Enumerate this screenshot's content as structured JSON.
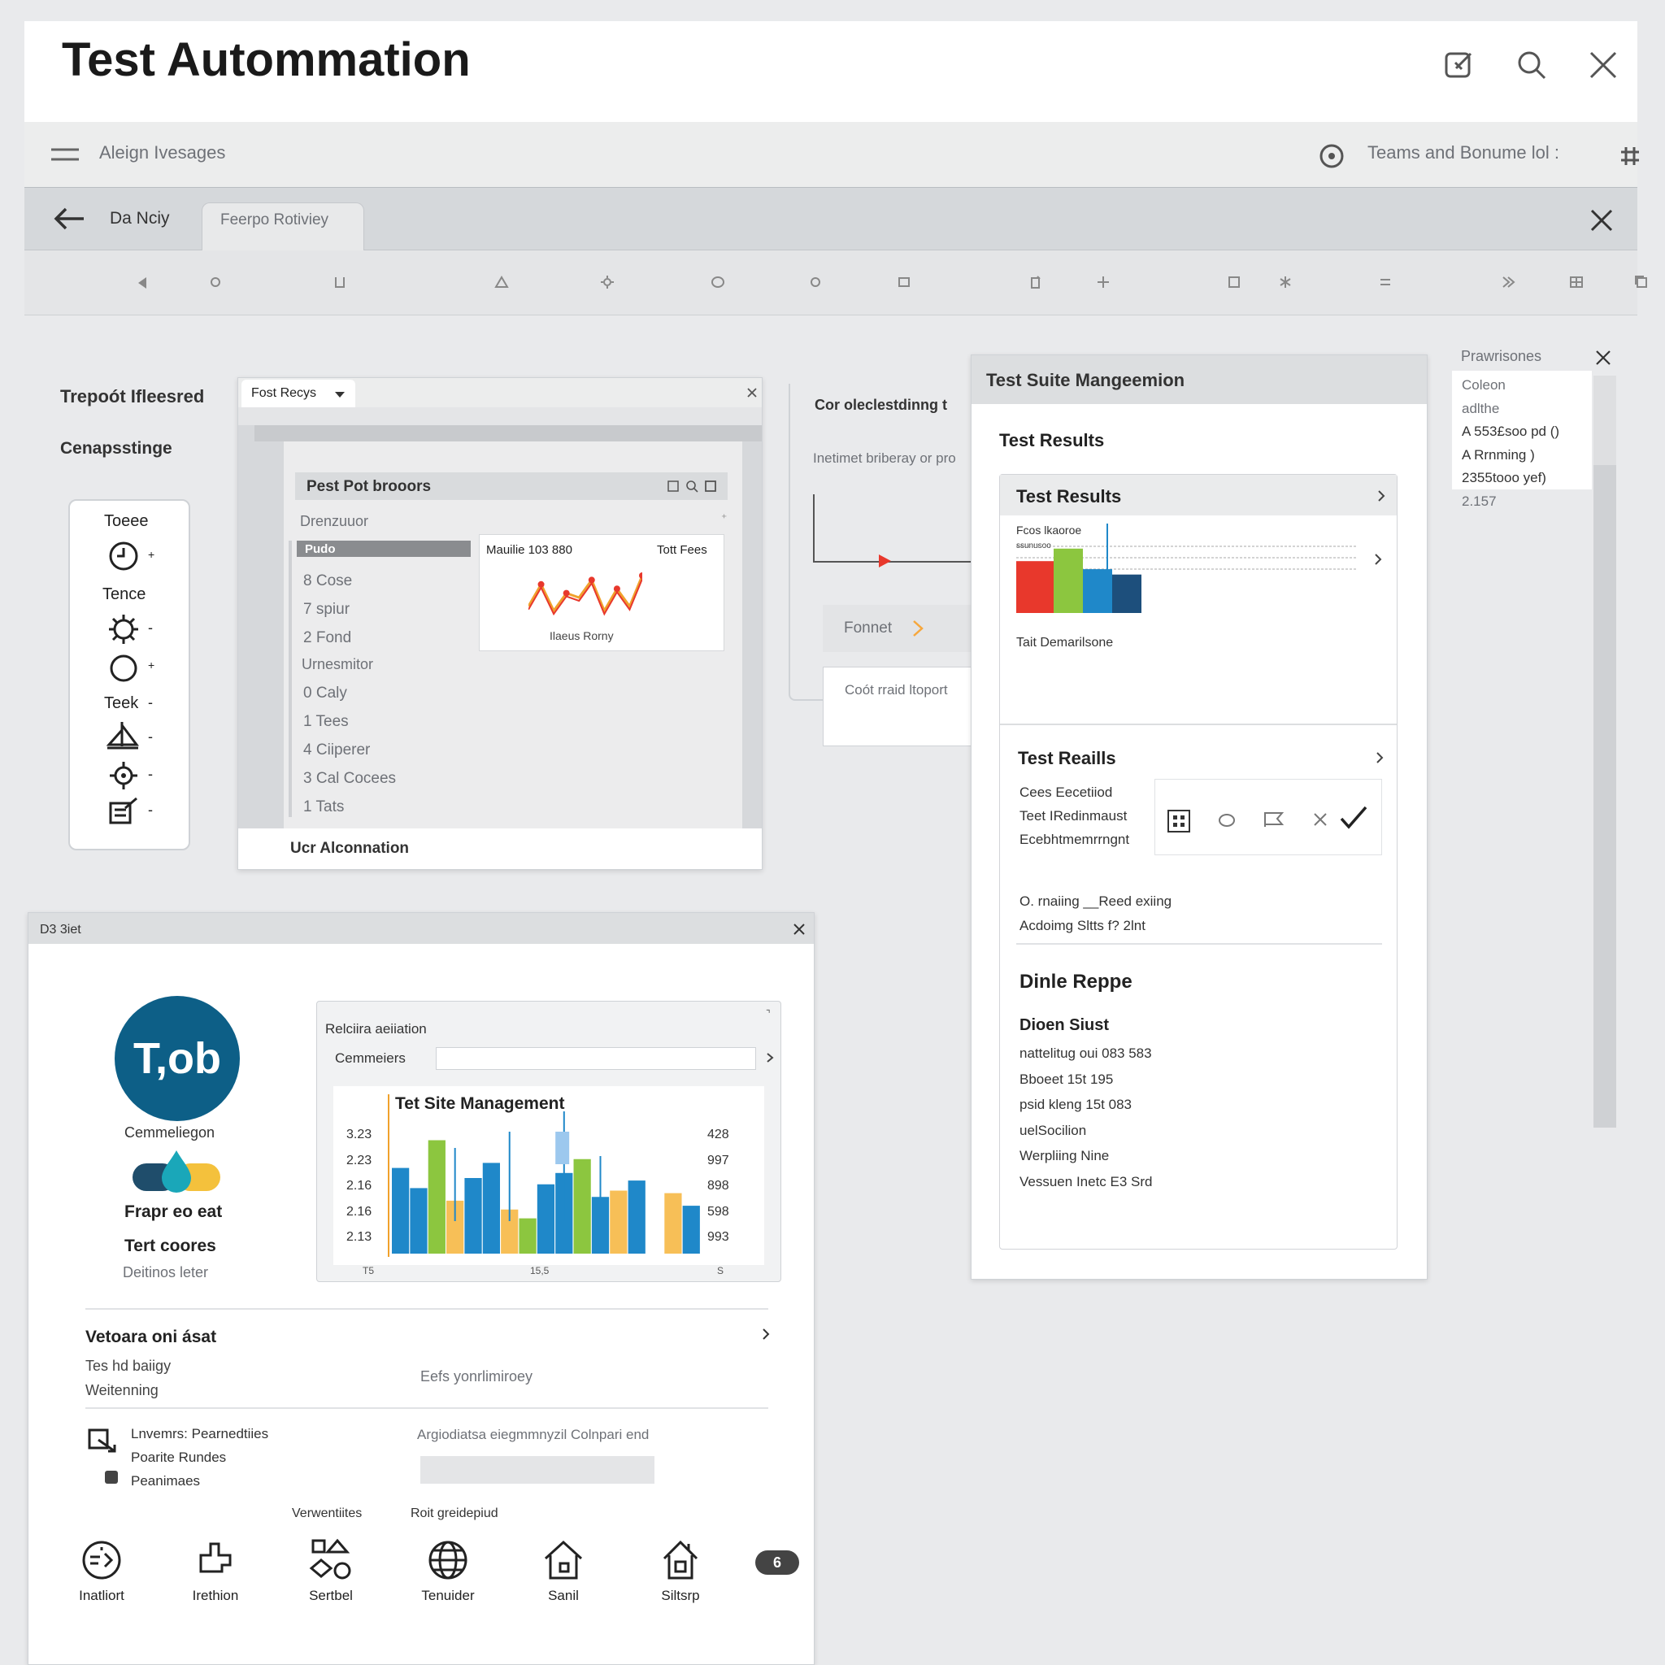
{
  "app": {
    "title": "Test Autommation"
  },
  "topbar": {
    "left_text": "Aleign Ivesages",
    "right_text": "Teams and Bonume lol :"
  },
  "tabs": {
    "items": [
      {
        "label": "Da Nciy"
      },
      {
        "label": "Feerpo Rotiviey"
      }
    ]
  },
  "left_labels": {
    "title1": "Trepoót Ifleesred",
    "title2": "Cenapsstinge"
  },
  "tool_panel": {
    "items": [
      {
        "label": "Toeee"
      },
      {
        "label": "Tence"
      },
      {
        "label": "Teek"
      }
    ]
  },
  "report_window": {
    "tab_label": "Fost Recys",
    "inner_title": "Pest Pot brooors",
    "column_label": "Drenzuuor",
    "selected_item": "Pudo",
    "items": [
      "8 Cose",
      "7 spiur",
      "2 Fond"
    ],
    "section_label": "Urnesmitor",
    "items2": [
      "0 Caly",
      "1 Tees",
      "4 Ciiperer",
      "3 Cal Cocees",
      "1 Tats"
    ],
    "card_title_left": "Mauilie 103 880",
    "card_title_right": "Tott Fees",
    "card_caption": "Ilaeus Rorny",
    "footer": "Ucr Alconnation"
  },
  "mid_panel": {
    "title": "Cor oleclestdinng t",
    "subtitle": "Inetimet briberay or pro",
    "button_label": "Fonnet",
    "box_text": "Coót rraid ltoport"
  },
  "suite_window": {
    "title": "Test Suite Mangeemion",
    "header": "Test Results",
    "card1_title": "Test Results",
    "card1_legend1": "Fcos lkaoroe",
    "card1_legend2": "ssunusoo",
    "card1_caption": "Tait Demarilsone",
    "card2_title": "Test Reaills",
    "card2_lines": [
      "Cees Eecetiiod",
      "Teet IRedinmaust",
      "Ecebhtmemrrngnt"
    ],
    "card2_extra": [
      "O. rnaiing __Reed exiing",
      "Acdoimg Sltts f? 2lnt"
    ],
    "section_title": "Dinle Reppe",
    "section_subtitle": "Dioen Siust",
    "section_lines": [
      "nattelitug oui 083 583",
      "Bboeet 15t 195",
      "psid kleng 15t 083",
      "uelSocilion",
      "Werpliing Nine",
      "Vessuen Inetc E3 Srd"
    ]
  },
  "side_list": {
    "title": "Prawrisones",
    "items": [
      "Coleon",
      "adlthe",
      "A 553£soo pd ()",
      "A Rrnming )",
      "2355tooo yef)",
      "2.157"
    ]
  },
  "bottom_window": {
    "title": "D3 3iet",
    "logo_text": "T,ob",
    "logo_caption": "Cemmeliegon",
    "label1": "Frapr eo eat",
    "label2": "Tert coores",
    "label3": "Deitinos leter",
    "chart_panel_title": "Relciira aeiiation",
    "chart_input_label": "Cemmeiers",
    "chart_title": "Tet Site Management",
    "y_left": [
      "3.23",
      "2.23",
      "2.16",
      "2.16",
      "2.13"
    ],
    "y_right": [
      "428",
      "997",
      "898",
      "598",
      "993"
    ],
    "x_ticks": [
      "T5",
      "15,5",
      "S"
    ],
    "section1_title": "Vetoara oni ásat",
    "section1_lines": [
      "Tes hd baiigy",
      "Weitenning"
    ],
    "section1_right": "Eefs yonrlimiroey",
    "section2_lines": [
      "Lnvemrs: Pearnedtiies",
      "Poarite Rundes",
      "Peanimaes"
    ],
    "section2_right": "Argiodiatsa eiegmmnyzil Colnpari end",
    "col_label1": "Verwentiites",
    "col_label2": "Roit greidepiud",
    "bottom_icons": [
      {
        "label": "Inatliort"
      },
      {
        "label": "Irethion"
      },
      {
        "label": "Sertbel"
      },
      {
        "label": "Tenuider"
      },
      {
        "label": "Sanil"
      },
      {
        "label": "Siltsrp"
      }
    ],
    "badge": "6"
  },
  "colors": {
    "red": "#e8382c",
    "green": "#8cc63f",
    "blue": "#1f88c9",
    "navy": "#1d4f7c",
    "orange": "#f7bf57",
    "teal_logo": "#0d5f87"
  },
  "chart_data": [
    {
      "type": "line",
      "series": [
        {
          "values": [
            3,
            8,
            2,
            6,
            5,
            9,
            2,
            7,
            3,
            10
          ]
        }
      ]
    },
    {
      "type": "bar",
      "categories": [
        "1",
        "2",
        "3",
        "4"
      ],
      "series": [
        {
          "values": [
            58,
            72,
            49,
            43
          ]
        }
      ]
    },
    {
      "type": "bar",
      "title": "Tet Site Management",
      "series": [
        {
          "color": "#1f88c9",
          "values": [
            68,
            52,
            0,
            0,
            60,
            72,
            0,
            0,
            0,
            64,
            0,
            45,
            0,
            58,
            0,
            0,
            38
          ]
        },
        {
          "color": "#8cc63f",
          "values": [
            0,
            0,
            90,
            0,
            0,
            0,
            0,
            28,
            0,
            0,
            75,
            0,
            0,
            0,
            0,
            0,
            0
          ]
        },
        {
          "color": "#f7bf57",
          "values": [
            0,
            0,
            0,
            42,
            0,
            0,
            35,
            0,
            0,
            0,
            0,
            0,
            50,
            0,
            0,
            48,
            0
          ]
        },
        {
          "color": "#1f88c9",
          "values": [
            0,
            0,
            0,
            0,
            0,
            0,
            0,
            0,
            55,
            0,
            0,
            0,
            0,
            0,
            0,
            0,
            0
          ]
        }
      ]
    }
  ]
}
